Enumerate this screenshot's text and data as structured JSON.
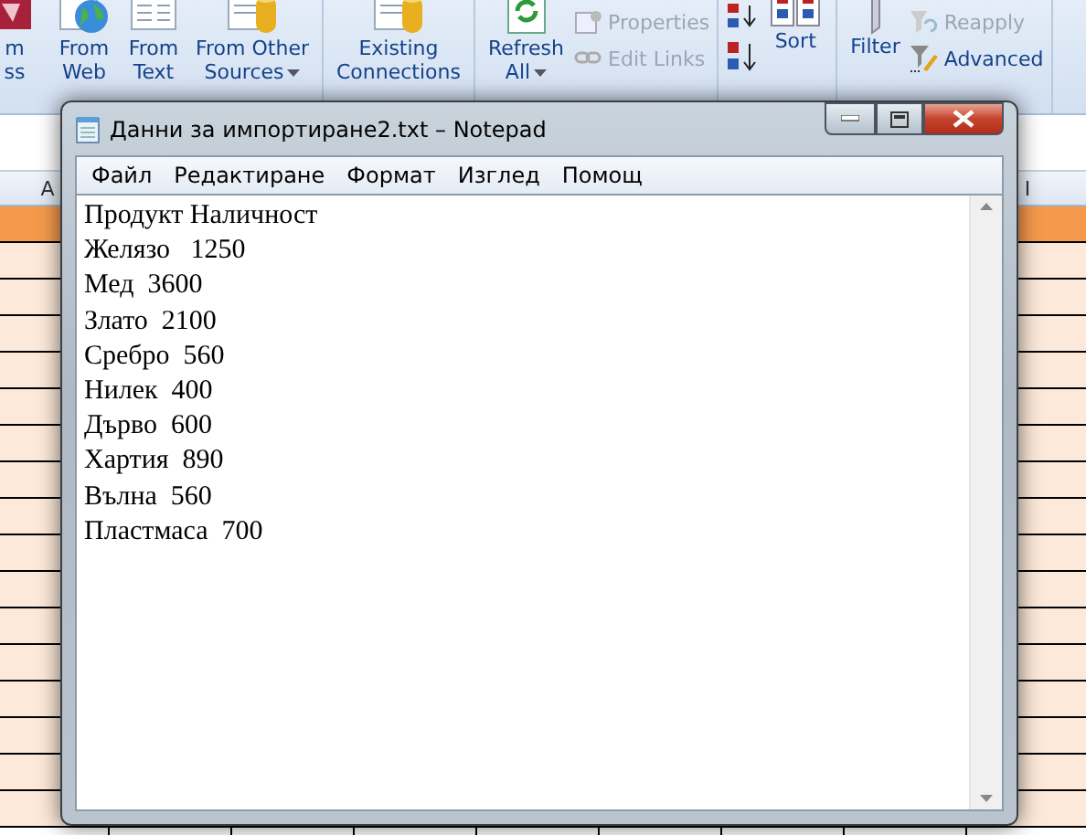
{
  "ribbon": {
    "groups": [
      {
        "items": [
          {
            "kind": "large",
            "lines": [
              "m",
              "ss"
            ]
          },
          {
            "kind": "large",
            "lines": [
              "From",
              "Web"
            ]
          },
          {
            "kind": "large",
            "lines": [
              "From",
              "Text"
            ]
          },
          {
            "kind": "large",
            "lines": [
              "From Other",
              "Sources"
            ],
            "menu": true
          }
        ]
      },
      {
        "items": [
          {
            "kind": "large",
            "lines": [
              "Existing",
              "Connections"
            ]
          }
        ]
      },
      {
        "items": [
          {
            "kind": "large",
            "lines": [
              "Refresh",
              "All"
            ],
            "menu": true
          },
          {
            "kind": "small",
            "label": "Properties",
            "disabled": true
          },
          {
            "kind": "small",
            "label": "Edit Links",
            "disabled": true
          }
        ]
      },
      {
        "items": [
          {
            "kind": "sorticons"
          },
          {
            "kind": "large",
            "lines": [
              "Sort"
            ]
          }
        ]
      },
      {
        "items": [
          {
            "kind": "large",
            "lines": [
              "Filter"
            ]
          },
          {
            "kind": "small",
            "label": "Reapply",
            "disabled": true
          },
          {
            "kind": "small",
            "label": "Advanced",
            "disabled": false
          }
        ]
      }
    ]
  },
  "sheet": {
    "column_headers": [
      "A",
      "I"
    ]
  },
  "notepad": {
    "title": "Данни за импортиране2.txt – Notepad",
    "menu": [
      "Файл",
      "Редактиране",
      "Формат",
      "Изглед",
      "Помощ"
    ],
    "lines": [
      "Продукт Наличност",
      "Желязо   1250",
      "Мед  3600",
      "Злато  2100",
      "Сребро  560",
      "Нилек  400",
      "Дърво  600",
      "Хартия  890",
      "Вълна  560",
      "Пластмаса  700"
    ]
  }
}
